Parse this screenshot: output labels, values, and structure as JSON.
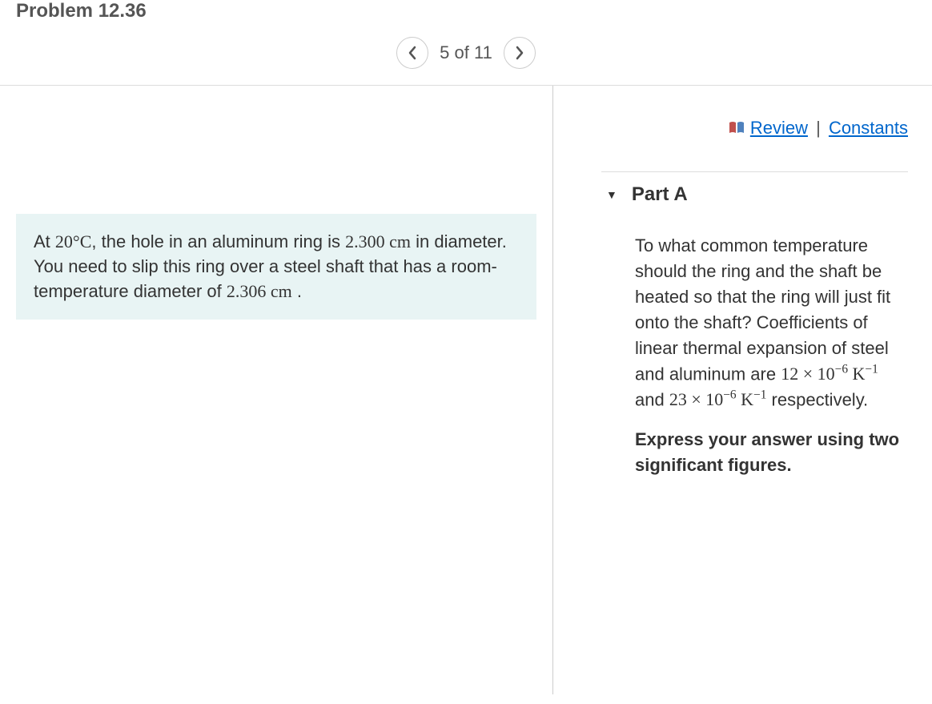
{
  "header": {
    "title": "Problem 12.36",
    "nav_counter": "5 of 11"
  },
  "links": {
    "review": "Review",
    "constants": "Constants",
    "separator": "|"
  },
  "problem": {
    "text_pre": "At ",
    "temp": "20°",
    "temp_unit": "C",
    "text_mid1": ", the hole in an aluminum ring is ",
    "diameter1": "2.300",
    "unit1": " cm",
    "text_mid2": " in diameter. You need to slip this ring over a steel shaft that has a room-temperature diameter of ",
    "diameter2": "2.306",
    "unit2": " cm",
    "text_end": " ."
  },
  "part": {
    "label": "Part A",
    "question_pre": "To what common temperature should the ring and the shaft be heated so that the ring will just fit onto the shaft? Coefficients of linear thermal expansion of steel and aluminum are ",
    "coef1_base": "12 × 10",
    "coef1_exp": "−6",
    "coef1_unit": " K",
    "coef1_unit_exp": "−1",
    "and": " and ",
    "coef2_base": "23 × 10",
    "coef2_exp": "−6",
    "coef2_unit": " K",
    "coef2_unit_exp": "−1",
    "question_post": " respectively.",
    "instruction": "Express your answer using two significant figures."
  }
}
